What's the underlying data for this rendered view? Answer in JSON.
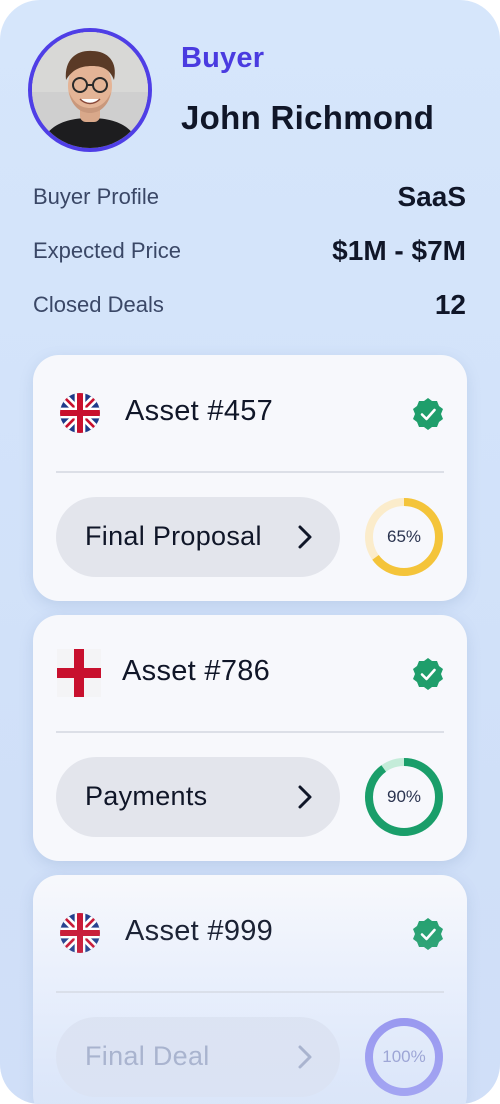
{
  "profile": {
    "role": "Buyer",
    "name": "John Richmond"
  },
  "stats": [
    {
      "label": "Buyer Profile",
      "value": "SaaS"
    },
    {
      "label": "Expected Price",
      "value": "$1M - $7M"
    },
    {
      "label": "Closed Deals",
      "value": "12"
    }
  ],
  "assets": [
    {
      "title": "Asset #457",
      "flag": "uk-flag-icon",
      "status_icon": "verified-check-icon",
      "stage": "Final Proposal",
      "progress_label": "65%",
      "progress": 0.65,
      "ring_color": "#f4c43a",
      "ring_track": "#fbeccb"
    },
    {
      "title": "Asset #786",
      "flag": "england-flag-icon",
      "status_icon": "verified-check-icon",
      "stage": "Payments",
      "progress_label": "90%",
      "progress": 0.9,
      "ring_color": "#1a9e6a",
      "ring_track": "#c4ecd9"
    },
    {
      "title": "Asset #999",
      "flag": "uk-flag-icon",
      "status_icon": "verified-check-icon",
      "stage": "Final Deal",
      "progress_label": "100%",
      "progress": 1.0,
      "ring_color": "#8b86ee",
      "ring_track": "#d9d8f8"
    }
  ],
  "colors": {
    "accent": "#4f3ee6",
    "verified": "#1f9e6b"
  }
}
